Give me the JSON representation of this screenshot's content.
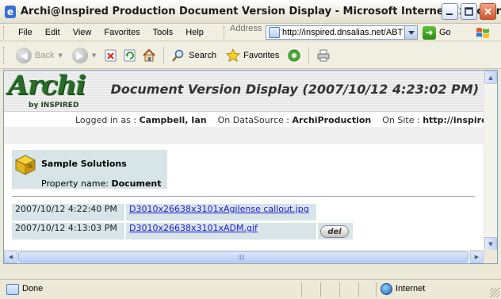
{
  "window": {
    "title": "Archi@Inspired Production Document Version Display - Microsoft Internet Explorer",
    "app_icon": "e-icon"
  },
  "menu": {
    "items": [
      "File",
      "Edit",
      "View",
      "Favorites",
      "Tools",
      "Help"
    ]
  },
  "address": {
    "label": "Address",
    "url": "http://inspired.dnsalias.net/ABT",
    "go_label": "Go"
  },
  "toolbar": {
    "back_label": "Back",
    "search_label": "Search",
    "favorites_label": "Favorites"
  },
  "page": {
    "logo_text": "Archi",
    "logo_byline": "by INSPIRED",
    "banner_title": "Document Version Display (2007/10/12 4:23:02 PM)",
    "logged_in_label": "Logged in as :",
    "logged_in_user": "Campbell, Ian",
    "datasource_label": "On DataSource :",
    "datasource": "ArchiProduction",
    "site_label": "On Site :",
    "site": "http://inspired.dnsalias."
  },
  "property": {
    "title": "Sample Solutions",
    "name_label": "Property name:",
    "name_value": "Document"
  },
  "versions": [
    {
      "date": "2007/10/12 4:22:40 PM",
      "file": "D3010x26638x3101xAgilense callout.jpg",
      "has_delete": false
    },
    {
      "date": "2007/10/12 4:13:03 PM",
      "file": "D3010x26638x3101xADM.gif",
      "has_delete": true,
      "delete_label": "del"
    }
  ],
  "status": {
    "text": "Done",
    "zone": "Internet"
  },
  "colors": {
    "panel_bg": "#D7E4E8",
    "link": "#1B1BD6",
    "logo_green": "#2A6A2A"
  }
}
